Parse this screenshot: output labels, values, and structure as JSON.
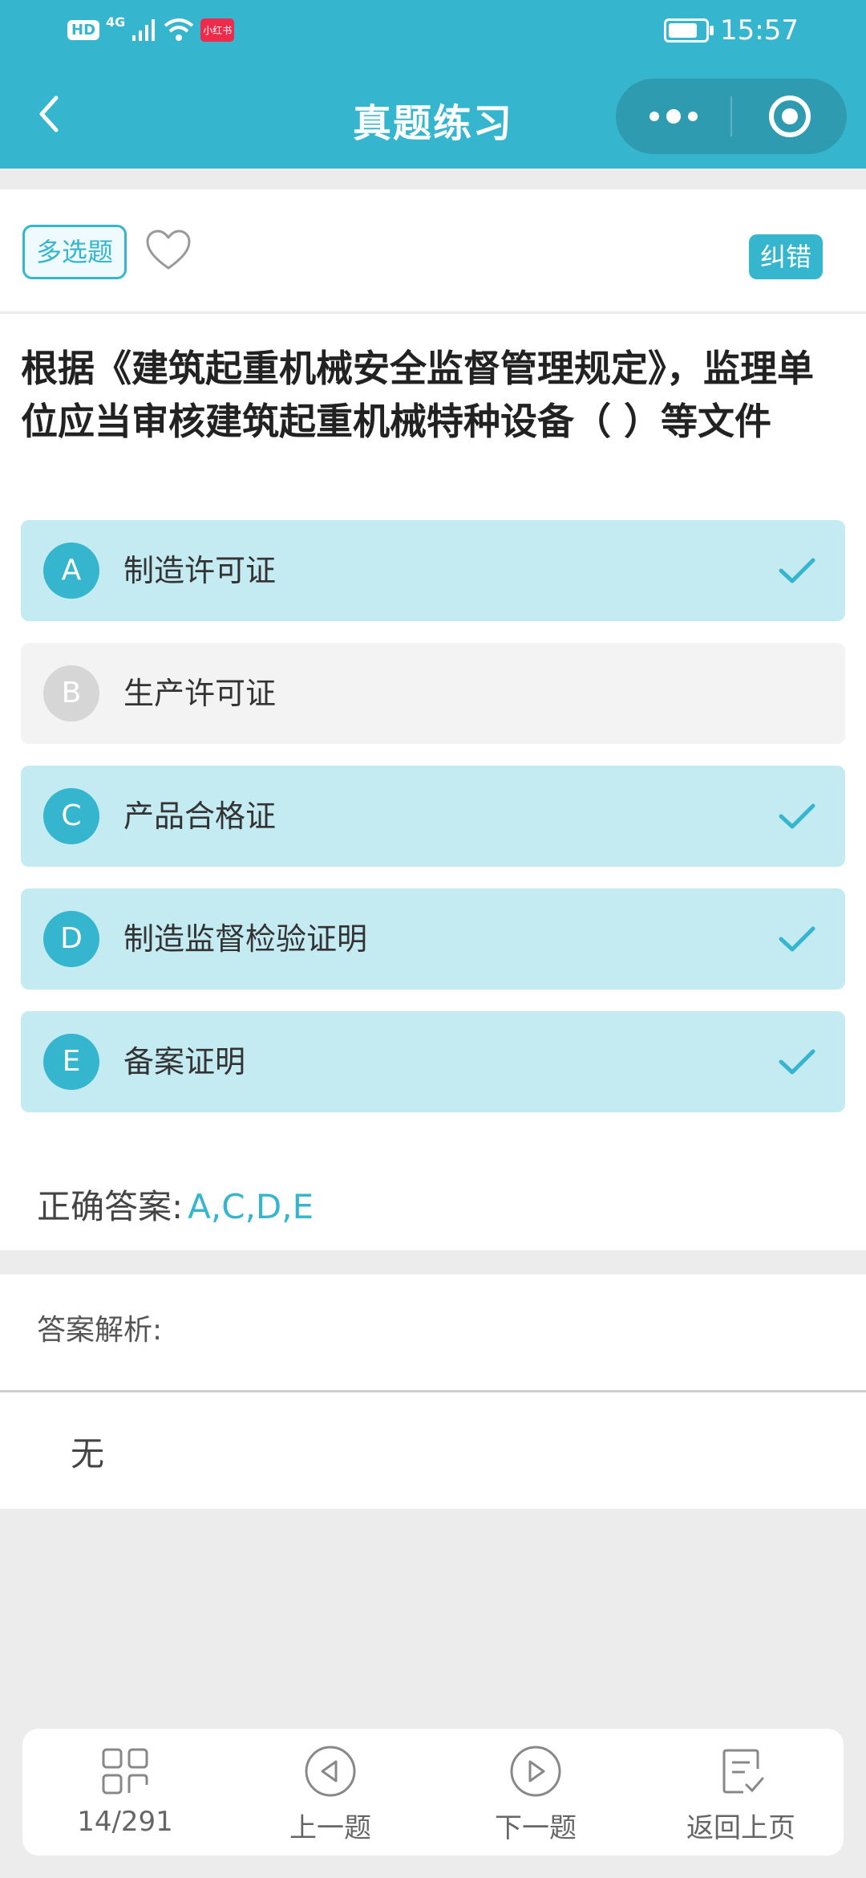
{
  "status_bar": {
    "hd": "HD",
    "network": "4G",
    "red_badge": "小红书",
    "time": "15:57",
    "battery_percent": 80
  },
  "nav": {
    "title": "真题练习",
    "back_icon": "chevron-left-icon",
    "more_icon": "more-dots-icon",
    "close_icon": "target-circle-icon"
  },
  "question": {
    "type_tag": "多选题",
    "favorite_icon": "heart-outline-icon",
    "report_label": "纠错",
    "text": "根据《建筑起重机械安全监督管理规定》，监理单位应当审核建筑起重机械特种设备（ ）等文件",
    "options": [
      {
        "letter": "A",
        "text": "制造许可证",
        "selected": true
      },
      {
        "letter": "B",
        "text": "生产许可证",
        "selected": false
      },
      {
        "letter": "C",
        "text": "产品合格证",
        "selected": true
      },
      {
        "letter": "D",
        "text": "制造监督检验证明",
        "selected": true
      },
      {
        "letter": "E",
        "text": "备案证明",
        "selected": true
      }
    ],
    "answer_label": "正确答案:",
    "answer_value": "A,C,D,E"
  },
  "analysis": {
    "label": "答案解析:",
    "text": "无"
  },
  "bottom_bar": {
    "progress": "14/291",
    "prev_label": "上一题",
    "next_label": "下一题",
    "return_label": "返回上页"
  },
  "colors": {
    "accent": "#36b5cf",
    "selected_bg": "#c4eaf2",
    "unselected_bg": "#f3f3f3",
    "page_bg": "#ececec"
  }
}
